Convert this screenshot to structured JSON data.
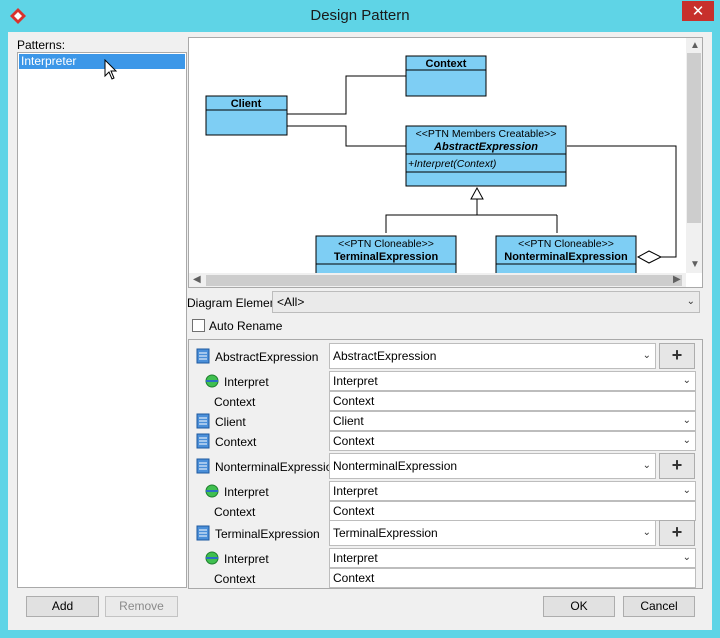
{
  "window": {
    "title": "Design Pattern",
    "close_glyph": "✕"
  },
  "patterns": {
    "label": "Patterns:",
    "items": [
      "Interpreter"
    ]
  },
  "diagram": {
    "classes": {
      "context": {
        "name": "Context"
      },
      "client": {
        "name": "Client"
      },
      "abstract": {
        "stereotype": "<<PTN Members Creatable>>",
        "name": "AbstractExpression",
        "operation": "+Interpret(Context)"
      },
      "terminal": {
        "stereotype": "<<PTN Cloneable>>",
        "name": "TerminalExpression"
      },
      "nonterminal": {
        "stereotype": "<<PTN Cloneable>>",
        "name": "NonterminalExpression"
      }
    }
  },
  "diagram_element": {
    "label": "Diagram Element",
    "value": "<All>"
  },
  "auto_rename": {
    "label": "Auto Rename",
    "checked": false
  },
  "roles": [
    {
      "label": "AbstractExpression",
      "value": "AbstractExpression"
    },
    {
      "label": "Interpret",
      "value": "Interpret"
    },
    {
      "label": "Context",
      "value": "Context"
    },
    {
      "label": "Client",
      "value": "Client"
    },
    {
      "label": "Context",
      "value": "Context"
    },
    {
      "label": "NonterminalExpression",
      "value": "NonterminalExpression"
    },
    {
      "label": "Interpret",
      "value": "Interpret"
    },
    {
      "label": "Context",
      "value": "Context"
    },
    {
      "label": "TerminalExpression",
      "value": "TerminalExpression"
    },
    {
      "label": "Interpret",
      "value": "Interpret"
    },
    {
      "label": "Context",
      "value": "Context"
    }
  ],
  "plus_glyph": "+",
  "buttons": {
    "add": "Add",
    "remove": "Remove",
    "ok": "OK",
    "cancel": "Cancel"
  },
  "colors": {
    "titlebar": "#5fd4e6",
    "class_fill": "#7ecef4",
    "selection": "#3c97e8",
    "close": "#c7302c"
  }
}
